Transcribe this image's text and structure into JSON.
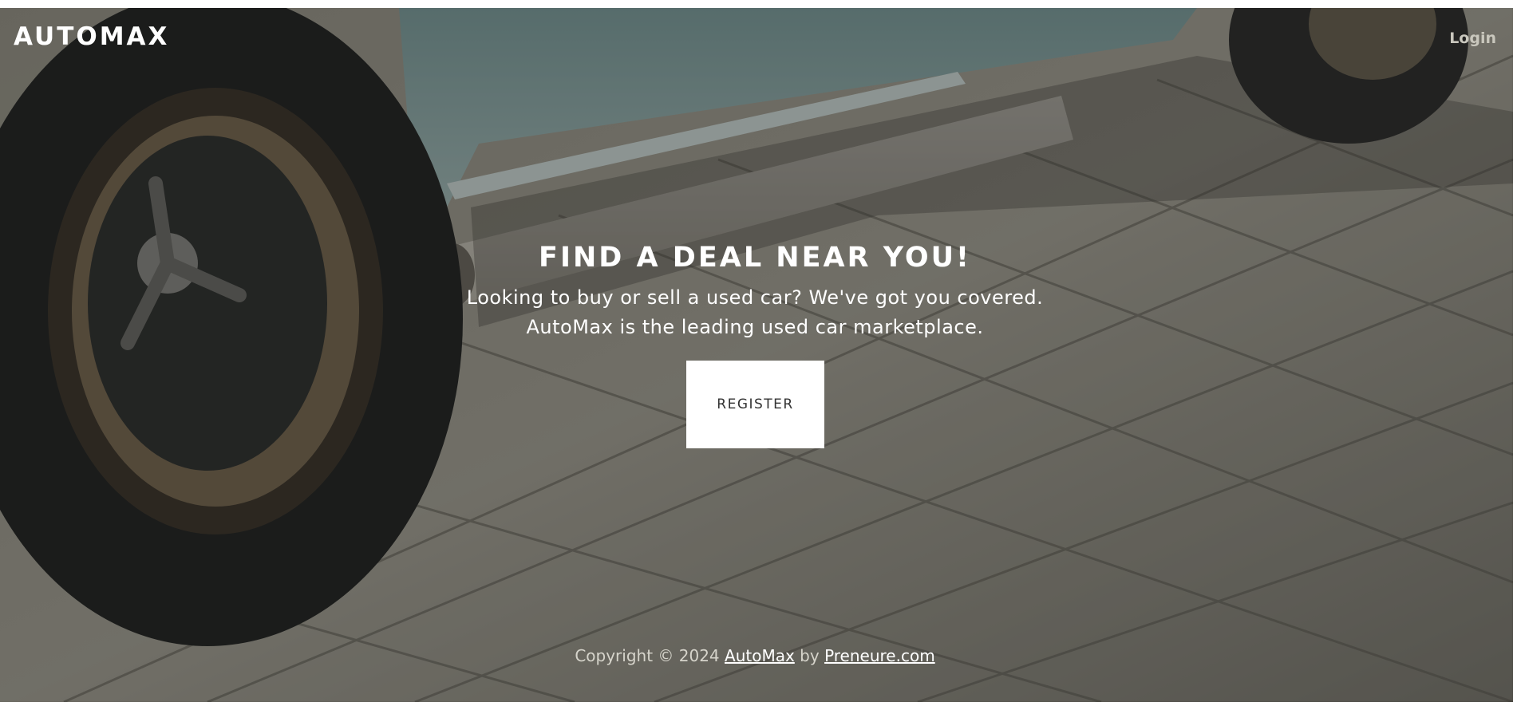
{
  "nav": {
    "brand": "AUTOMAX",
    "login_label": "Login"
  },
  "hero": {
    "headline": "FIND A DEAL NEAR YOU!",
    "subline_1": "Looking to buy or sell a used car? We've got you covered.",
    "subline_2": "AutoMax is the leading used car marketplace.",
    "register_label": "REGISTER"
  },
  "footer": {
    "copyright": "Copyright © 2024",
    "site_link": "AutoMax",
    "by": "by",
    "credit_link": "Preneure.com"
  },
  "colors": {
    "overlay": "#141614",
    "text": "#ffffff",
    "button_bg": "#ffffff",
    "button_text": "#333333"
  },
  "images": {
    "background": "car-wheel-on-paving-stones-photo"
  }
}
